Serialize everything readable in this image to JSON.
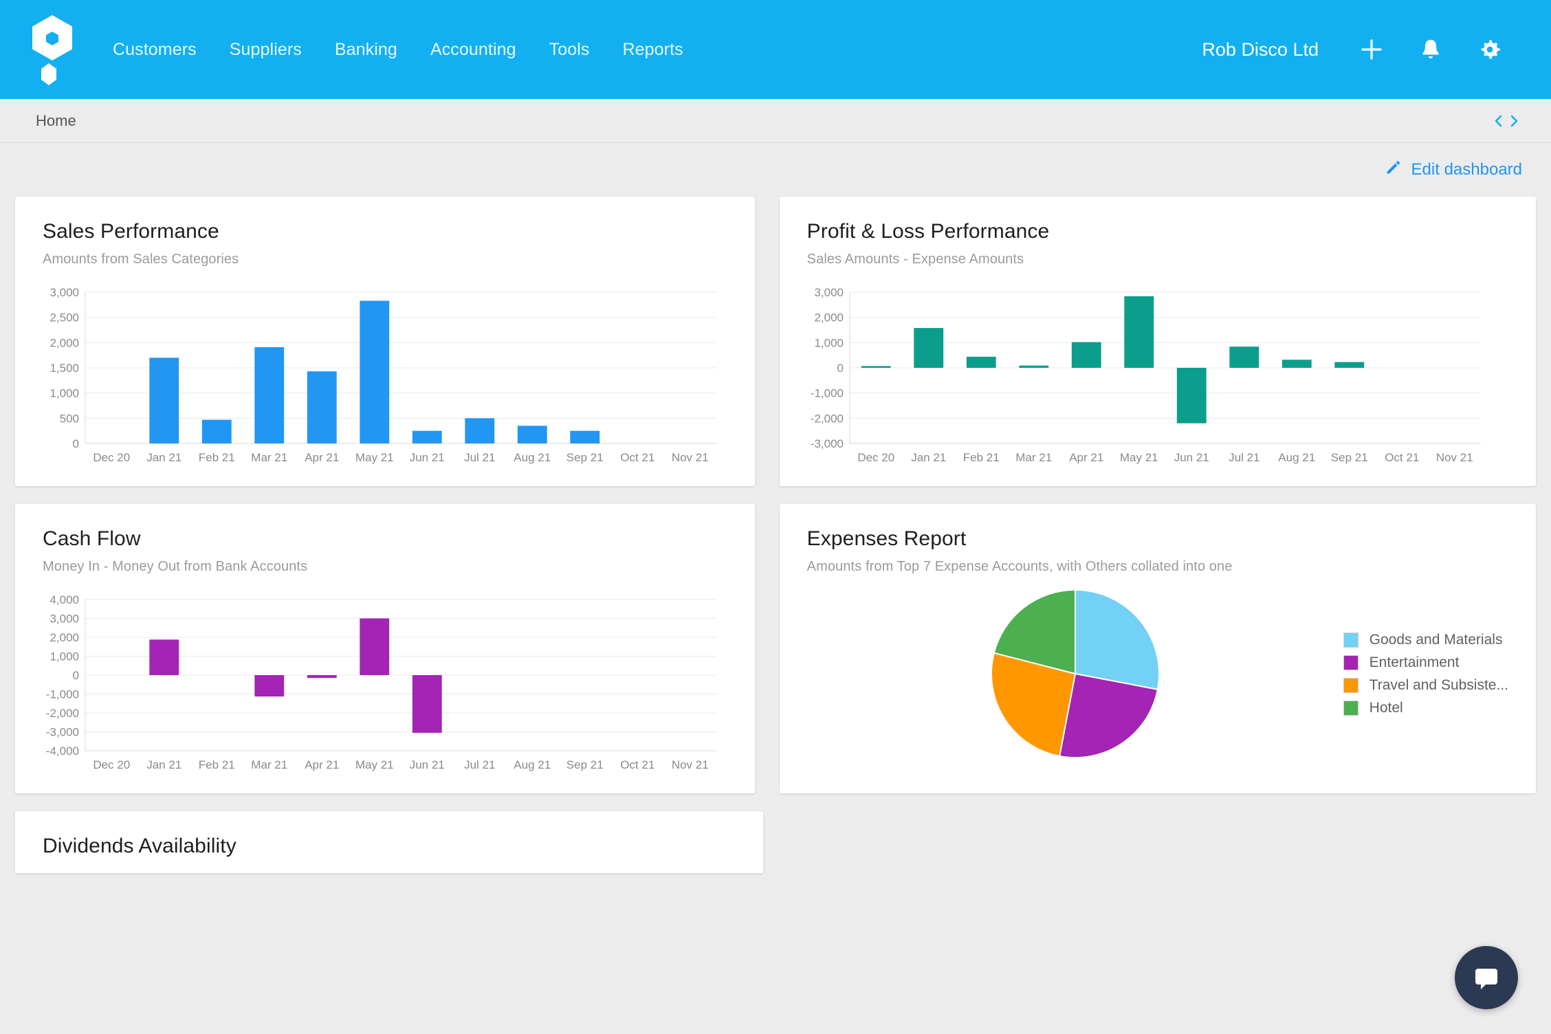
{
  "header": {
    "logo_icon": "hexagon-logo-icon",
    "nav_items": [
      {
        "label": "Customers"
      },
      {
        "label": "Suppliers"
      },
      {
        "label": "Banking"
      },
      {
        "label": "Accounting"
      },
      {
        "label": "Tools"
      },
      {
        "label": "Reports"
      }
    ],
    "company": "Rob Disco Ltd",
    "add_icon": "plus-icon",
    "bell_icon": "bell-icon",
    "settings_icon": "gear-icon",
    "brand_color": "#12b0f0"
  },
  "breadcrumb": {
    "label": "Home",
    "prev_icon": "chevron-left-icon",
    "next_icon": "chevron-right-icon"
  },
  "toolbar": {
    "edit_label": "Edit dashboard",
    "edit_icon": "pencil-icon",
    "link_color": "#2196f3"
  },
  "cards": {
    "sales": {
      "title": "Sales Performance",
      "subtitle": "Amounts from Sales Categories"
    },
    "profit_loss": {
      "title": "Profit & Loss Performance",
      "subtitle": "Sales Amounts - Expense Amounts"
    },
    "cash_flow": {
      "title": "Cash Flow",
      "subtitle": "Money In - Money Out from Bank Accounts"
    },
    "expenses": {
      "title": "Expenses Report",
      "subtitle": "Amounts from Top 7 Expense Accounts, with Others collated into one"
    },
    "dividends": {
      "title": "Dividends Availability"
    }
  },
  "chat": {
    "icon": "chat-icon"
  },
  "chart_data": [
    {
      "id": "sales",
      "type": "bar",
      "title": "Sales Performance",
      "subtitle": "Amounts from Sales Categories",
      "categories": [
        "Dec 20",
        "Jan 21",
        "Feb 21",
        "Mar 21",
        "Apr 21",
        "May 21",
        "Jun 21",
        "Jul 21",
        "Aug 21",
        "Sep 21",
        "Oct 21",
        "Nov 21"
      ],
      "values": [
        0,
        1700,
        470,
        1910,
        1430,
        2830,
        250,
        500,
        350,
        250,
        0,
        0
      ],
      "ytick_labels": [
        "3,000",
        "2,500",
        "2,000",
        "1,500",
        "1,000",
        "500",
        "0"
      ],
      "yticks": [
        3000,
        2500,
        2000,
        1500,
        1000,
        500,
        0
      ],
      "ylim": [
        0,
        3000
      ],
      "xlabel": "",
      "ylabel": "",
      "color": "#2196f3",
      "grid": true,
      "legend": "none"
    },
    {
      "id": "profit_loss",
      "type": "bar",
      "title": "Profit & Loss Performance",
      "subtitle": "Sales Amounts - Expense Amounts",
      "categories": [
        "Dec 20",
        "Jan 21",
        "Feb 21",
        "Mar 21",
        "Apr 21",
        "May 21",
        "Jun 21",
        "Jul 21",
        "Aug 21",
        "Sep 21",
        "Oct 21",
        "Nov 21"
      ],
      "values": [
        70,
        1580,
        440,
        90,
        1020,
        2840,
        -2200,
        840,
        320,
        230,
        0,
        0
      ],
      "ytick_labels": [
        "3,000",
        "2,000",
        "1,000",
        "0",
        "-1,000",
        "-2,000",
        "-3,000"
      ],
      "yticks": [
        3000,
        2000,
        1000,
        0,
        -1000,
        -2000,
        -3000
      ],
      "ylim": [
        -3000,
        3000
      ],
      "xlabel": "",
      "ylabel": "",
      "color": "#0b9e8c",
      "grid": true,
      "legend": "none"
    },
    {
      "id": "cash_flow",
      "type": "bar",
      "title": "Cash Flow",
      "subtitle": "Money In - Money Out from Bank Accounts",
      "categories": [
        "Dec 20",
        "Jan 21",
        "Feb 21",
        "Mar 21",
        "Apr 21",
        "May 21",
        "Jun 21",
        "Jul 21",
        "Aug 21",
        "Sep 21",
        "Oct 21",
        "Nov 21"
      ],
      "values": [
        0,
        1880,
        0,
        -1130,
        -150,
        3000,
        -3050,
        0,
        0,
        0,
        0,
        0
      ],
      "ytick_labels": [
        "4,000",
        "3,000",
        "2,000",
        "1,000",
        "0",
        "-1,000",
        "-2,000",
        "-3,000",
        "-4,000"
      ],
      "yticks": [
        4000,
        3000,
        2000,
        1000,
        0,
        -1000,
        -2000,
        -3000,
        -4000
      ],
      "ylim": [
        -4000,
        4000
      ],
      "xlabel": "",
      "ylabel": "",
      "color": "#a324b5",
      "grid": true,
      "legend": "none"
    },
    {
      "id": "expenses",
      "type": "pie",
      "title": "Expenses Report",
      "subtitle": "Amounts from Top 7 Expense Accounts, with Others collated into one",
      "labels": [
        "Goods and Materials",
        "Entertainment",
        "Travel and Subsiste...",
        "Hotel"
      ],
      "values": [
        28,
        25,
        26,
        21
      ],
      "colors": [
        "#72d1f4",
        "#a324b5",
        "#ff9800",
        "#4caf50"
      ],
      "legend": "right"
    }
  ]
}
